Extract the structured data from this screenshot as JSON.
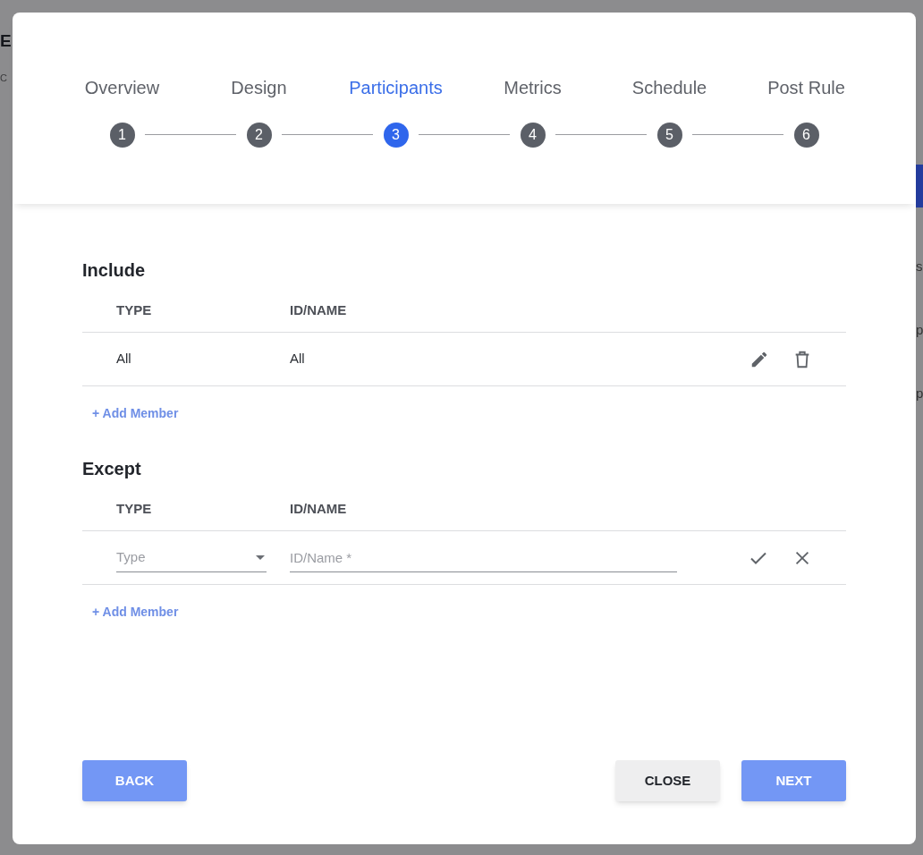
{
  "background": {
    "title_fragment": "E",
    "subtitle_fragment": "C",
    "right_fragments": [
      "s",
      "p",
      "p"
    ]
  },
  "stepper": {
    "steps": [
      {
        "label": "Overview",
        "number": "1",
        "selected": false
      },
      {
        "label": "Design",
        "number": "2",
        "selected": false
      },
      {
        "label": "Participants",
        "number": "3",
        "selected": true
      },
      {
        "label": "Metrics",
        "number": "4",
        "selected": false
      },
      {
        "label": "Schedule",
        "number": "5",
        "selected": false
      },
      {
        "label": "Post Rule",
        "number": "6",
        "selected": false
      }
    ]
  },
  "sections": [
    {
      "title": "Include",
      "columns": [
        "TYPE",
        "ID/NAME"
      ],
      "rows": [
        {
          "kind": "data",
          "type": "All",
          "id_name": "All"
        }
      ],
      "add_link": "+ Add Member"
    },
    {
      "title": "Except",
      "columns": [
        "TYPE",
        "ID/NAME"
      ],
      "rows": [
        {
          "kind": "editing",
          "type_placeholder": "Type",
          "id_placeholder": "ID/Name *"
        }
      ],
      "add_link": "+ Add Member"
    }
  ],
  "footer": {
    "back": "BACK",
    "close": "CLOSE",
    "next": "NEXT"
  }
}
